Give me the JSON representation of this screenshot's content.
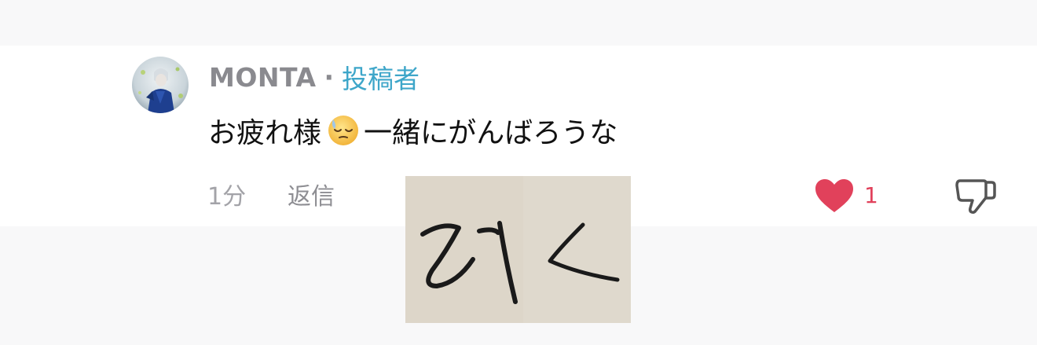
{
  "comment": {
    "author_name": "MONTA",
    "separator": "·",
    "author_badge": "投稿者",
    "text_before_emoji": "お疲れ様",
    "emoji": "sleepy-face",
    "text_after_emoji": "一緒にがんばろうな",
    "time_ago": "1分",
    "reply_label": "返信",
    "like_count": "1",
    "liked": true
  },
  "sticker": {
    "handwritten_text": "みく"
  },
  "colors": {
    "author_name": "#8a8a8f",
    "badge": "#3ea6c9",
    "like": "#e1415b",
    "meta": "#a3a3a8"
  }
}
